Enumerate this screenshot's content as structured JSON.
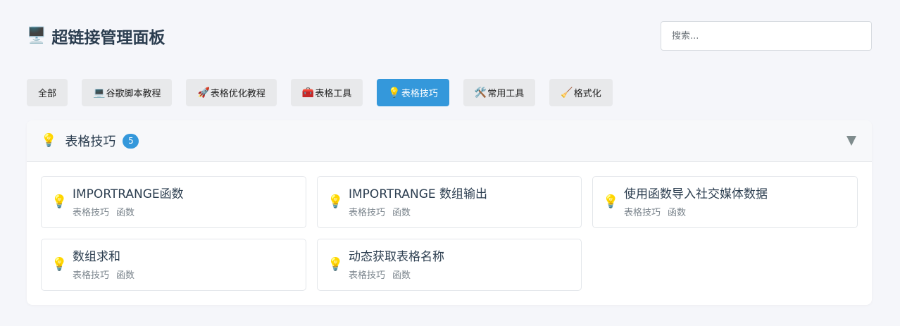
{
  "header": {
    "icon": "🖥️",
    "icon_name": "desktop-computer-icon",
    "title": "超链接管理面板",
    "search_placeholder": "搜索..."
  },
  "tabs": [
    {
      "icon": "",
      "label": "全部",
      "active": false
    },
    {
      "icon": "💻",
      "label": "谷歌脚本教程",
      "active": false
    },
    {
      "icon": "🚀",
      "label": "表格优化教程",
      "active": false
    },
    {
      "icon": "🧰",
      "label": "表格工具",
      "active": false
    },
    {
      "icon": "💡",
      "label": "表格技巧",
      "active": true
    },
    {
      "icon": "🛠️",
      "label": "常用工具",
      "active": false
    },
    {
      "icon": "🧹",
      "label": "格式化",
      "active": false
    }
  ],
  "panel": {
    "icon": "💡",
    "title": "表格技巧",
    "count": "5",
    "accent": "#3498db",
    "items": [
      {
        "icon": "💡",
        "name": "IMPORTRANGE函数",
        "category": "表格技巧",
        "tag": "函数"
      },
      {
        "icon": "💡",
        "name": "IMPORTRANGE 数组输出",
        "category": "表格技巧",
        "tag": "函数"
      },
      {
        "icon": "💡",
        "name": "使用函数导入社交媒体数据",
        "category": "表格技巧",
        "tag": "函数"
      },
      {
        "icon": "💡",
        "name": "数组求和",
        "category": "表格技巧",
        "tag": "函数"
      },
      {
        "icon": "💡",
        "name": "动态获取表格名称",
        "category": "表格技巧",
        "tag": "函数"
      }
    ]
  }
}
